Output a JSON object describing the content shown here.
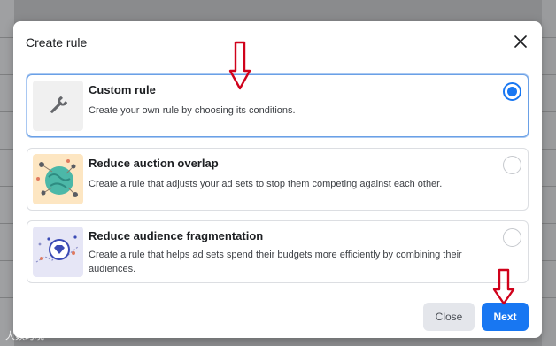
{
  "dialog": {
    "title": "Create rule",
    "close_icon": "close-icon"
  },
  "options": [
    {
      "title": "Custom rule",
      "description": "Create your own rule by choosing its conditions.",
      "icon": "wrench-icon",
      "selected": true
    },
    {
      "title": "Reduce auction overlap",
      "description": "Create a rule that adjusts your ad sets to stop them competing against each other.",
      "icon": "globe-network-icon",
      "selected": false
    },
    {
      "title": "Reduce audience fragmentation",
      "description": "Create a rule that helps ad sets spend their budgets more efficiently by combining their audiences.",
      "icon": "audience-target-icon",
      "selected": false
    }
  ],
  "footer": {
    "close_label": "Close",
    "next_label": "Next"
  },
  "annotations": {
    "arrow_color": "#d0021b"
  },
  "watermark": "大数跨境",
  "colors": {
    "primary": "#1877f2",
    "selected_border": "#6aa0e6",
    "secondary_button": "#e4e6eb"
  }
}
